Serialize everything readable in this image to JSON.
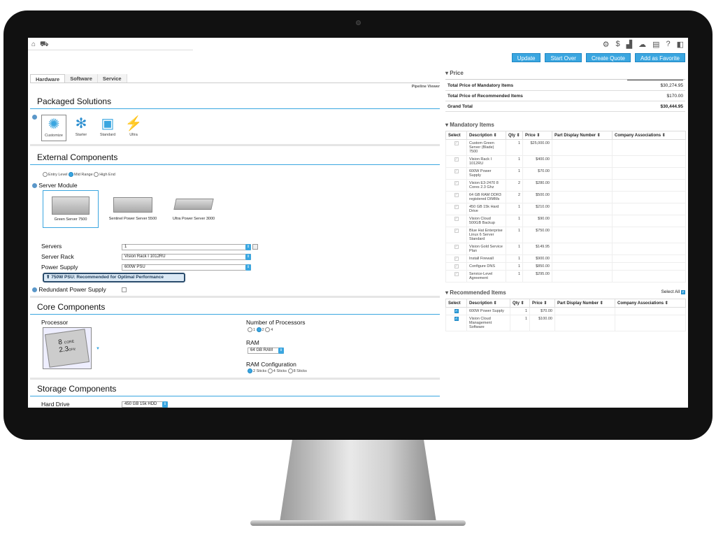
{
  "header": {
    "buttons": [
      "Update",
      "Start Over",
      "Create Quote",
      "Add as Favorite"
    ]
  },
  "tabs": [
    "Hardware",
    "Software",
    "Service"
  ],
  "pipeline_viewer": "Pipeline Viewer",
  "packaged": {
    "title": "Packaged Solutions",
    "items": [
      "Customize",
      "Starter",
      "Standard",
      "Ultra"
    ]
  },
  "external": {
    "title": "External Components",
    "levels": [
      "Entry Level",
      "Mid Range",
      "High End"
    ],
    "server_module": "Server Module",
    "products": [
      "Green Server 7500",
      "Sentinel Power Server 5500",
      "Ultra Power Server 3000"
    ],
    "servers_label": "Servers",
    "servers_value": "1",
    "rack_label": "Server Rack",
    "rack_value": "Vision Rack I 1012RU",
    "psu_label": "Power Supply",
    "psu_value": "600W PSU",
    "recommend": "750W PSU: Recommended for Optimal Performance",
    "redundant": "Redundant Power Supply"
  },
  "core": {
    "title": "Core Components",
    "processor": "Processor",
    "chip_line1": "8",
    "chip_core": "CORE",
    "chip_line2": "2.3",
    "chip_ghz": "GHz",
    "nproc_label": "Number of Processors",
    "nproc": [
      "1",
      "2",
      "4"
    ],
    "ram_label": "RAM",
    "ram_value": "64 GB RAM",
    "ramcfg_label": "RAM Configuration",
    "ramcfg": [
      "2 Sticks",
      "4 Sticks",
      "8 Sticks"
    ]
  },
  "storage": {
    "title": "Storage Components",
    "hd_label": "Hard Drive",
    "hd_value": "450 GB 15k HDD"
  },
  "price": {
    "title": "Price",
    "rows": [
      [
        "Total Price of Mandatory Items",
        "$30,274.95"
      ],
      [
        "Total Price of Recommended Items",
        "$170.00"
      ],
      [
        "Grand Total",
        "$30,444.95"
      ]
    ]
  },
  "mandatory": {
    "title": "Mandatory Items",
    "headers": [
      "Select",
      "Description",
      "Qty",
      "Price",
      "Part Display Number",
      "Company Associations"
    ],
    "rows": [
      [
        "Custom Green Server (Blade) 7500",
        "1",
        "$25,000.00"
      ],
      [
        "Vision Rack I 1012RU",
        "1",
        "$400.00"
      ],
      [
        "600W Power Supply",
        "1",
        "$70.00"
      ],
      [
        "Vision E3-2470 8 Cores 2.3 Ghz",
        "2",
        "$280.00"
      ],
      [
        "64 GB RAM DDR3 registered DIMMs",
        "2",
        "$500.00"
      ],
      [
        "450 GB 15k Hard Drive",
        "1",
        "$210.00"
      ],
      [
        "Vision Cloud 500GB Backup",
        "1",
        "$90.00"
      ],
      [
        "Blue Hat Enterprise Linux 6 Server Standard",
        "1",
        "$750.00"
      ],
      [
        "Vision Gold Service Plan",
        "1",
        "$149.95"
      ],
      [
        "Install Firewall",
        "1",
        "$900.00"
      ],
      [
        "Configure DNS",
        "1",
        "$850.00"
      ],
      [
        "Service-Level Agreement",
        "1",
        "$295.00"
      ]
    ]
  },
  "recommended": {
    "title": "Recommended Items",
    "select_all": "Select All",
    "headers": [
      "Select",
      "Description",
      "Qty",
      "Price",
      "Part Display Number",
      "Company Associations"
    ],
    "rows": [
      [
        "600W Power Supply",
        "1",
        "$70.00"
      ],
      [
        "Vision Cloud Management Software",
        "1",
        "$100.00"
      ]
    ]
  }
}
